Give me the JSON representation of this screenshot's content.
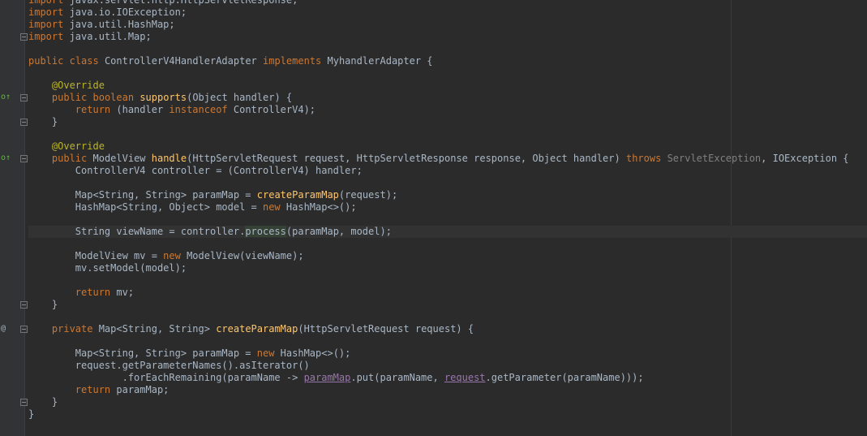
{
  "editor": {
    "lines": [
      {
        "type": "text",
        "text": "import javax.servlet.http.HttpServletResponse;"
      },
      {
        "type": "text",
        "text": "import java.io.IOException;"
      },
      {
        "type": "text",
        "text": "import java.util.HashMap;"
      },
      {
        "type": "text",
        "text": "import java.util.Map;"
      },
      {
        "type": "blank"
      },
      {
        "type": "class",
        "text": "public class ControllerV4HandlerAdapter implements MyhandlerAdapter {"
      },
      {
        "type": "blank"
      },
      {
        "type": "annotation",
        "text": "    @Override"
      },
      {
        "type": "method",
        "text": "    public boolean supports(Object handler) {"
      },
      {
        "type": "text",
        "text": "        return (handler instanceof ControllerV4);"
      },
      {
        "type": "text",
        "text": "    }"
      },
      {
        "type": "blank"
      },
      {
        "type": "annotation",
        "text": "    @Override"
      },
      {
        "type": "method",
        "text": "    public ModelView handle(HttpServletRequest request, HttpServletResponse response, Object handler) throws ServletException, IOException {"
      },
      {
        "type": "text",
        "text": "        ControllerV4 controller = (ControllerV4) handler;"
      },
      {
        "type": "blank"
      },
      {
        "type": "text",
        "text": "        Map<String, String> paramMap = createParamMap(request);"
      },
      {
        "type": "text",
        "text": "        HashMap<String, Object> model = new HashMap<>();"
      },
      {
        "type": "blank"
      },
      {
        "type": "current",
        "text": "        String viewName = controller.process(paramMap, model);"
      },
      {
        "type": "blank"
      },
      {
        "type": "text",
        "text": "        ModelView mv = new ModelView(viewName);"
      },
      {
        "type": "text",
        "text": "        mv.setModel(model);"
      },
      {
        "type": "blank"
      },
      {
        "type": "text",
        "text": "        return mv;"
      },
      {
        "type": "text",
        "text": "    }"
      },
      {
        "type": "blank"
      },
      {
        "type": "method",
        "text": "    private Map<String, String> createParamMap(HttpServletRequest request) {"
      },
      {
        "type": "blank"
      },
      {
        "type": "text",
        "text": "        Map<String, String> paramMap = new HashMap<>();"
      },
      {
        "type": "text",
        "text": "        request.getParameterNames().asIterator()"
      },
      {
        "type": "text",
        "text": "                .forEachRemaining(paramName -> paramMap.put(paramName, request.getParameter(paramName)));"
      },
      {
        "type": "text",
        "text": "        return paramMap;"
      },
      {
        "type": "text",
        "text": "    }"
      },
      {
        "type": "text",
        "text": "}"
      }
    ]
  },
  "gutter": {
    "markers": [
      {
        "line": 8,
        "icon": "override-icon",
        "symbol": "o↑"
      },
      {
        "line": 13,
        "icon": "override-icon",
        "symbol": "o↑"
      },
      {
        "line": 27,
        "icon": "at-icon",
        "symbol": "@"
      }
    ]
  },
  "colors": {
    "background": "#2b2b2b",
    "keyword": "#cc7832",
    "annotation": "#bbb529",
    "method": "#ffc66d",
    "text": "#a9b7c6",
    "field": "#9876aa"
  }
}
